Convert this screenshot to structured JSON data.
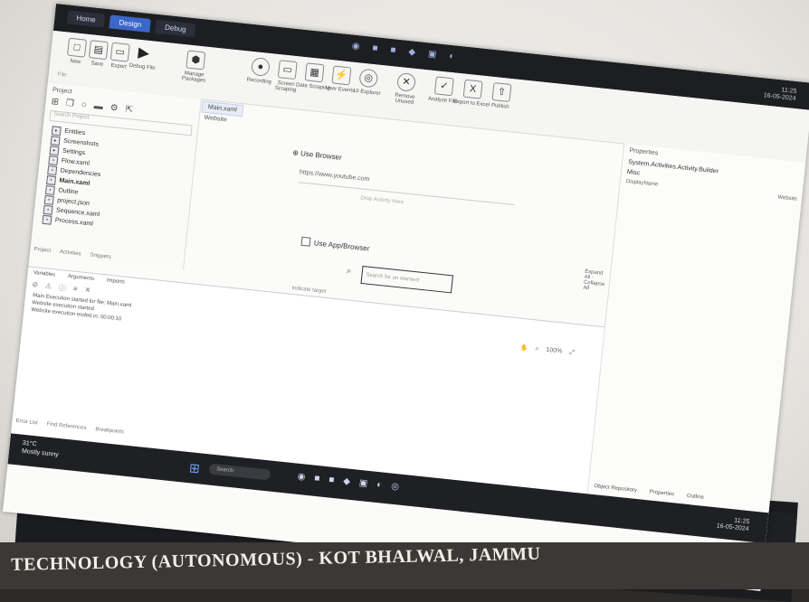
{
  "titlebar": {
    "tabs": [
      "Home",
      "Design",
      "Debug"
    ],
    "active_tab": 1,
    "clock": {
      "time": "11:25",
      "date": "16-05-2024"
    }
  },
  "ribbon": {
    "buttons": [
      {
        "label": "New",
        "icon": "new-icon"
      },
      {
        "label": "Save",
        "icon": "save-icon"
      },
      {
        "label": "Export",
        "icon": "export-icon"
      },
      {
        "label": "Debug File",
        "icon": "play-icon"
      },
      {
        "label": "Manage Packages",
        "icon": "package-icon"
      },
      {
        "label": "Recording",
        "icon": "record-icon"
      },
      {
        "label": "Screen Scraping",
        "icon": "scrape-icon"
      },
      {
        "label": "Data Scraping",
        "icon": "table-icon"
      },
      {
        "label": "User Events",
        "icon": "events-icon"
      },
      {
        "label": "UI Explorer",
        "icon": "explorer-icon"
      },
      {
        "label": "Remove Unused",
        "icon": "remove-icon"
      },
      {
        "label": "Analyze File",
        "icon": "analyze-icon"
      },
      {
        "label": "Export to Excel",
        "icon": "excel-icon"
      },
      {
        "label": "Publish",
        "icon": "publish-icon"
      }
    ],
    "group_label": "File"
  },
  "project": {
    "header": "Project",
    "search_placeholder": "Search Project",
    "tree": [
      {
        "label": "Entities",
        "icon": "folder-icon",
        "bold": false
      },
      {
        "label": "Screenshots",
        "icon": "folder-icon",
        "bold": false
      },
      {
        "label": "Settings",
        "icon": "folder-icon",
        "bold": false
      },
      {
        "label": "Flow.xaml",
        "icon": "file-icon",
        "bold": false
      },
      {
        "label": "Dependencies",
        "icon": "file-icon",
        "bold": false
      },
      {
        "label": "Main.xaml",
        "icon": "file-icon",
        "bold": true
      },
      {
        "label": "Outline",
        "icon": "file-icon",
        "bold": false
      },
      {
        "label": "project.json",
        "icon": "file-icon",
        "bold": false
      },
      {
        "label": "Sequence.xaml",
        "icon": "file-icon",
        "bold": false
      },
      {
        "label": "Process.xaml",
        "icon": "file-icon",
        "bold": false
      }
    ],
    "footer_tabs": [
      "Project",
      "Activities",
      "Snippets"
    ]
  },
  "editor": {
    "doc_tab": "Main.xaml",
    "doc_name": "Website",
    "sequence_title": "Use Browser",
    "url": "https://www.youtube.com",
    "drop_hint": "Drop Activity Here",
    "use_app_label": "Use App/Browser",
    "find_placeholder": "Search for an element",
    "link_text": "Indicate target",
    "expand_label": "Expand All",
    "collapse_label": "Collapse All"
  },
  "properties": {
    "header": "Properties",
    "line1": "System.Activities.Activity.Builder",
    "section": "Misc",
    "sub_label": "DisplayName",
    "sub_value": "Website",
    "footer": [
      "Object Repository",
      "Properties",
      "Outline"
    ]
  },
  "output": {
    "tabs": [
      "Variables",
      "Arguments",
      "Imports"
    ],
    "lines": [
      "Main Execution started for file: Main.xaml",
      "Website execution started",
      "Website execution ended in: 00:00:10"
    ],
    "status": [
      "Error List",
      "Find References",
      "Breakpoints"
    ],
    "zoom": "100%"
  },
  "taskbar": {
    "weather_temp": "31°C",
    "weather_desc": "Mostly sunny",
    "search_label": "Search",
    "clock": {
      "time": "11:25",
      "date": "16-05-2024"
    }
  },
  "caption": {
    "text": "TECHNOLOGY (AUTONOMOUS) - KOT BHALWAL, JAMMU"
  }
}
